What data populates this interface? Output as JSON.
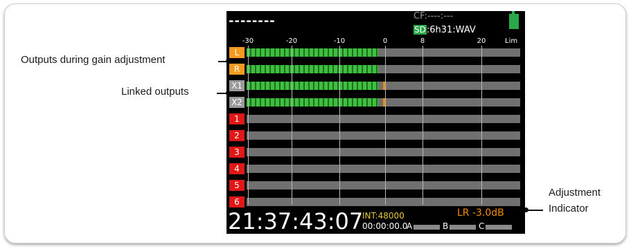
{
  "callouts": {
    "gain_outputs": "Outputs during gain adjustment",
    "linked_outputs": "Linked outputs",
    "adjustment_line1": "Adjustment",
    "adjustment_line2": "Indicator"
  },
  "screen": {
    "take_name": "--------",
    "cf_status": "CF:----:---",
    "sd_badge": "SD",
    "media_status": ":6h31:WAV",
    "scale": [
      "-30",
      "-20",
      "-10",
      "0",
      "8",
      "20"
    ],
    "scale_lim": "Lim",
    "channels": [
      {
        "label": "L",
        "group": "gain",
        "level_db": 0
      },
      {
        "label": "R",
        "group": "gain",
        "level_db": 0
      },
      {
        "label": "X1",
        "group": "linked",
        "level_db": 0,
        "peak": true
      },
      {
        "label": "X2",
        "group": "linked",
        "level_db": 0,
        "peak": true
      },
      {
        "label": "1",
        "group": "input",
        "level_db": null
      },
      {
        "label": "2",
        "group": "input",
        "level_db": null
      },
      {
        "label": "3",
        "group": "input",
        "level_db": null
      },
      {
        "label": "4",
        "group": "input",
        "level_db": null
      },
      {
        "label": "5",
        "group": "input",
        "level_db": null
      },
      {
        "label": "6",
        "group": "input",
        "level_db": null
      }
    ],
    "timecode": "21:37:43:07",
    "sample_rate": "INT:48000",
    "counter": "00:00:00.0",
    "adjustment": "LR -3.0dB",
    "slots": [
      "A",
      "B",
      "C"
    ],
    "colors": {
      "meter_green": "#3fbf3f",
      "peak_orange": "#f08a00",
      "gain_tag": "#f39a1f",
      "linked_tag": "#9a9a9a",
      "input_tag": "#e01818",
      "sample_rate_yellow": "#e3c93a"
    }
  }
}
